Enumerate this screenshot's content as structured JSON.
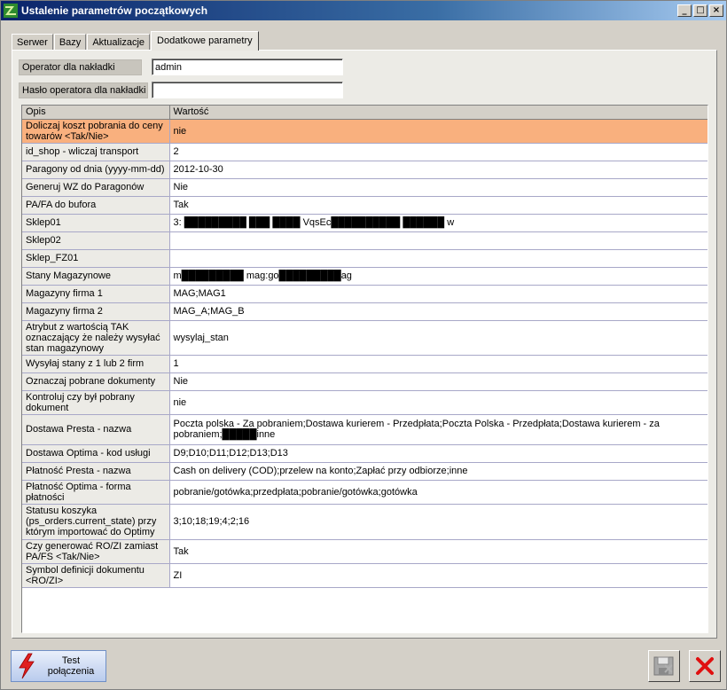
{
  "window": {
    "title": "Ustalenie parametrów początkowych",
    "buttons": {
      "minimize": "_",
      "maximize": "□",
      "close": "×"
    }
  },
  "tabs": [
    {
      "label": "Serwer",
      "active": false
    },
    {
      "label": "Bazy",
      "active": false
    },
    {
      "label": "Aktualizacje",
      "active": false
    },
    {
      "label": "Dodatkowe parametry",
      "active": true
    }
  ],
  "form": {
    "operator_label": "Operator dla nakładki",
    "operator_value": "admin",
    "password_label": "Hasło operatora dla nakładki",
    "password_value": ""
  },
  "grid": {
    "headers": [
      "Opis",
      "Wartość"
    ],
    "rows": [
      {
        "desc": "Doliczaj koszt pobrania do ceny towarów <Tak/Nie>",
        "value": "nie"
      },
      {
        "desc": "id_shop - wliczaj transport",
        "value": "2"
      },
      {
        "desc": "Paragony od dnia (yyyy-mm-dd)",
        "value": "2012-10-30"
      },
      {
        "desc": "Generuj WZ do Paragonów",
        "value": "Nie"
      },
      {
        "desc": "PA/FA do bufora",
        "value": "Tak"
      },
      {
        "desc": "Sklep01",
        "value": "3: █████████ ███ ████ VqsEc██████████ ██████ w"
      },
      {
        "desc": "Sklep02",
        "value": ""
      },
      {
        "desc": "Sklep_FZ01",
        "value": ""
      },
      {
        "desc": "Stany Magazynowe",
        "value": "m█████████ mag:go█████████ag"
      },
      {
        "desc": "Magazyny firma 1",
        "value": "MAG;MAG1"
      },
      {
        "desc": "Magazyny firma 2",
        "value": "MAG_A;MAG_B"
      },
      {
        "desc": "Atrybut z wartością TAK oznaczający że należy wysyłać stan magazynowy",
        "value": "wysylaj_stan"
      },
      {
        "desc": "Wysyłaj stany z 1 lub 2 firm",
        "value": "1"
      },
      {
        "desc": "Oznaczaj pobrane dokumenty",
        "value": "Nie"
      },
      {
        "desc": "Kontroluj czy był pobrany dokument",
        "value": "nie"
      },
      {
        "desc": "Dostawa Presta - nazwa",
        "value": "Poczta polska - Za pobraniem;Dostawa kurierem - Przedpłata;Poczta Polska - Przedpłata;Dostawa kurierem - za pobraniem;█████inne"
      },
      {
        "desc": "Dostawa Optima - kod usługi",
        "value": "D9;D10;D11;D12;D13;D13"
      },
      {
        "desc": "Płatność Presta - nazwa",
        "value": "Cash on delivery (COD);przelew na konto;Zapłać przy odbiorze;inne"
      },
      {
        "desc": "Płatność Optima - forma płatności",
        "value": "pobranie/gotówka;przedpłata;pobranie/gotówka;gotówka"
      },
      {
        "desc": "Statusu koszyka (ps_orders.current_state) przy którym importować do Optimy",
        "value": "3;10;18;19;4;2;16"
      },
      {
        "desc": "Czy generować RO/ZI zamiast PA/FS <Tak/Nie>",
        "value": "Tak"
      },
      {
        "desc": "Symbol definicji dokumentu <RO/ZI>",
        "value": "ZI"
      }
    ],
    "selected_row": 0
  },
  "bottom": {
    "test_button_line1": "Test",
    "test_button_line2": "połączenia"
  },
  "colors": {
    "selected_row": "#f9b07e",
    "title_start": "#0a246a",
    "title_end": "#a6caf0",
    "close_red": "#e01010"
  }
}
